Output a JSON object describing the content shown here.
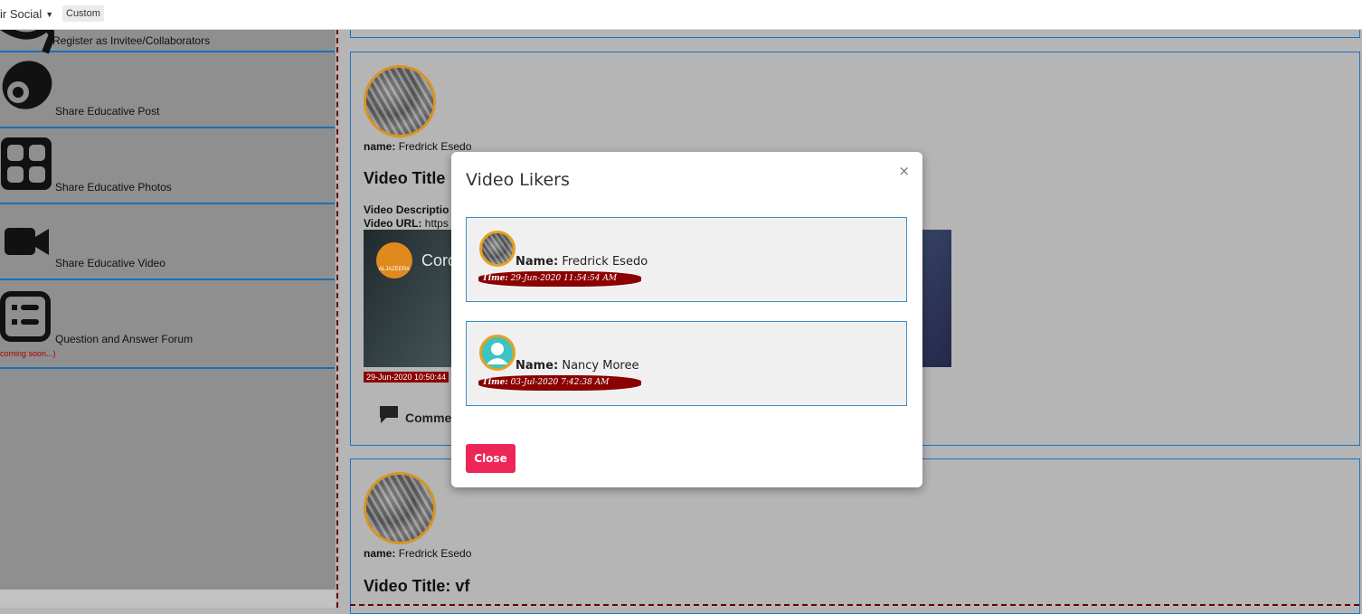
{
  "topbar": {
    "dropdown_label": "ir Social",
    "tag_label": "Custom"
  },
  "sidebar": {
    "items": [
      {
        "label": "Register as Invitee/Collaborators",
        "icon": "megaphone-icon"
      },
      {
        "label": "Share Educative Post",
        "icon": "post-icon"
      },
      {
        "label": "Share Educative Photos",
        "icon": "photos-grid-icon"
      },
      {
        "label": "Share Educative Video",
        "icon": "video-camera-icon"
      },
      {
        "label": "Question and Answer Forum",
        "icon": "list-icon",
        "note": "coming soon...)"
      }
    ]
  },
  "posts": [
    {
      "name_label": "name:",
      "name": "Fredrick Esedo",
      "title": "Video Title",
      "desc_label": "Video Descriptio",
      "url_label": "Video URL:",
      "url_value": "https",
      "video_caption": "Coro",
      "video_logo": "ALJAZEERA",
      "timestamp": "29-Jun-2020 10:50:44",
      "comment_label": "Comme"
    },
    {
      "name_label": "name:",
      "name": "Fredrick Esedo",
      "title": "Video Title: vf"
    }
  ],
  "modal": {
    "title": "Video Likers",
    "close_x": "×",
    "likers": [
      {
        "name_label": "Name:",
        "name": "Fredrick Esedo",
        "time_label": "Time:",
        "time": "29-Jun-2020 11:54:54 AM",
        "avatar": "photo"
      },
      {
        "name_label": "Name:",
        "name": "Nancy Moree",
        "time_label": "Time:",
        "time": "03-Jul-2020 7:42:38 AM",
        "avatar": "default"
      }
    ],
    "close_button": "Close"
  },
  "colors": {
    "accent_pink": "#ee2557",
    "time_badge": "#8b0000",
    "border_blue": "#1b73c0",
    "avatar_ring": "#d79522"
  }
}
